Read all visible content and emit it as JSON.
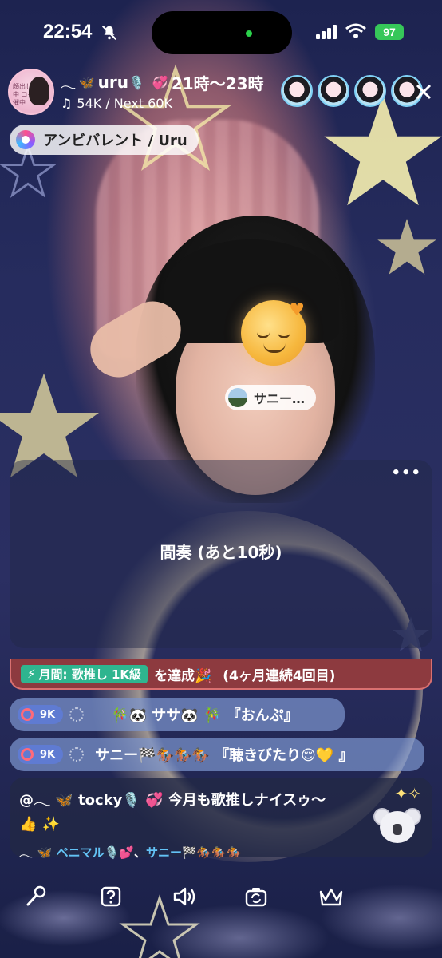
{
  "status_bar": {
    "time": "22:54",
    "battery": "97"
  },
  "header": {
    "host_name": "uru",
    "schedule": "21時〜23時",
    "fans_progress": "54K / Next 60K",
    "avatar_caption": "顔出し 配信中 コイン 開催中"
  },
  "now_playing": {
    "song": "アンビバレント / Uru"
  },
  "stage": {
    "name_tag": "サニー…",
    "interlude_text": "間奏 (あと10秒)",
    "more_label": "•••"
  },
  "chat": {
    "achievement": {
      "badge": "月間: 歌推し 1K級",
      "text": "を達成🎉",
      "suffix": "(4ヶ月連続4回目)"
    },
    "rows": [
      {
        "badge": "9K",
        "text": "🎋🐼 ササ🐼 🎋 『おんぷ』"
      },
      {
        "badge": "9K",
        "text": "サニー🏁🏇🏇🏇 『聴きびたり😌💛 』"
      }
    ],
    "comment": {
      "line1": "@𓂃 🦋 tocky🎙️ 💞  今月も歌推しナイスゥ〜",
      "line2": "👍 ✨",
      "line3_prefix": "𓂃 🦋 ",
      "mention1": "ベニマル",
      "mention1_suffix": "🎙️💕",
      "separator": "、",
      "mention2": "サニー",
      "mention2_suffix": "🏁🏇🏇🏇"
    }
  },
  "icons": {
    "dnd": "bell-slash-icon",
    "close": "close-icon",
    "mic": "microphone-icon",
    "question": "question-box-icon",
    "speaker": "speaker-icon",
    "camera": "camera-flip-icon",
    "crown": "crown-icon"
  },
  "colors": {
    "battery": "#36c759",
    "achievement_bg": "#8d3a3f",
    "chat_row_bg": "#7c94cd",
    "mention_blue": "#63c2f5"
  }
}
